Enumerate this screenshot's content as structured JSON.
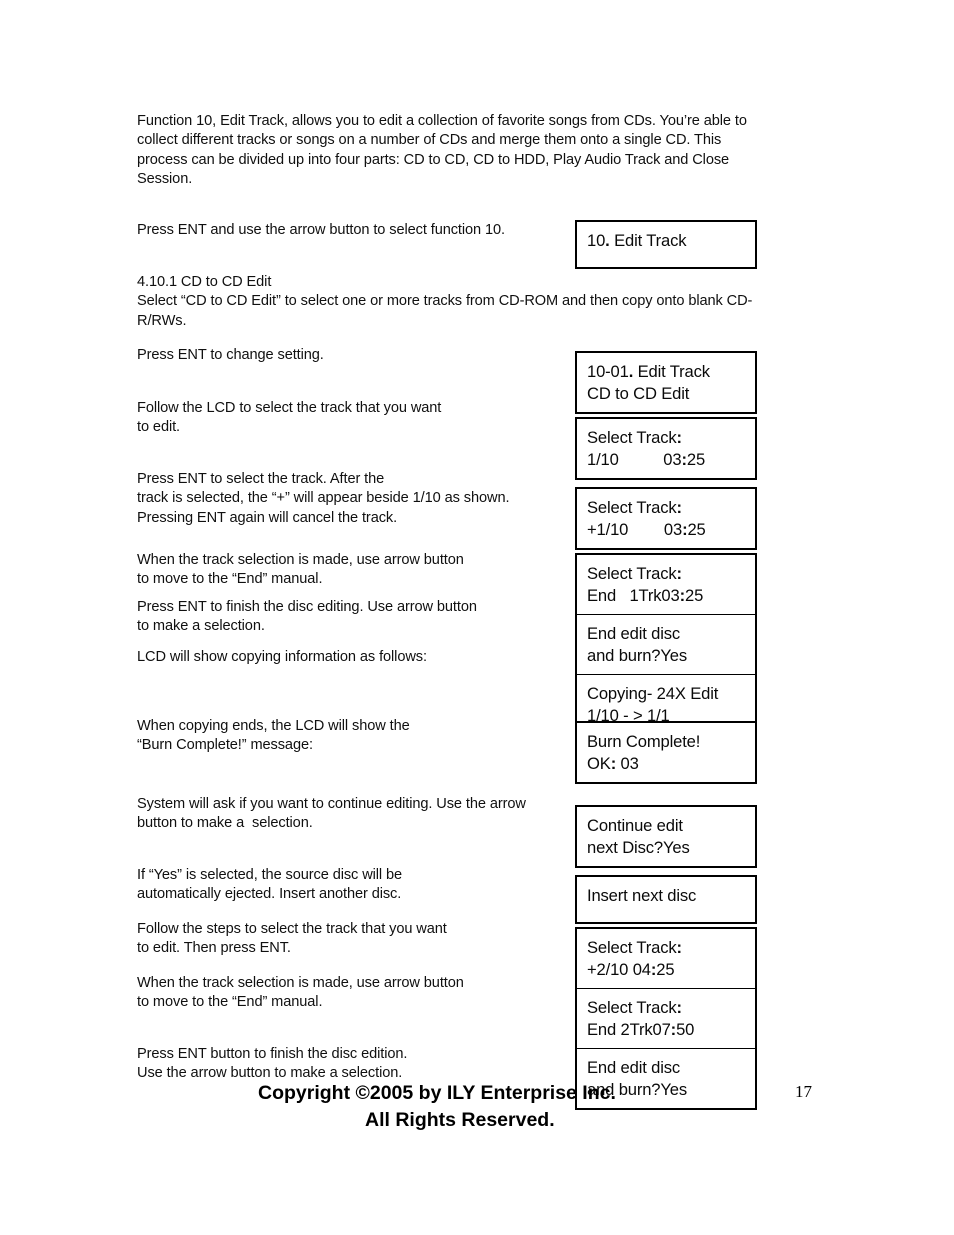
{
  "document": {
    "page_number": "17",
    "paragraphs": [
      {
        "id": "intro",
        "text": "Function 10, Edit Track, allows you to edit a collection of favorite songs from CDs. You’re able to\ncollect different tracks or songs on a number of CDs and merge them onto a single CD. This\nprocess can be divided up into four parts: CD to CD, CD to HDD, Play Audio Track and Close\nSession."
      },
      {
        "id": "press-ent-select-function",
        "text": "Press ENT and use the arrow button to select function 10."
      },
      {
        "id": "section-4-10-1",
        "text": "4.10.1 CD to CD Edit\nSelect “CD to CD Edit” to select one or more tracks from CD-ROM and then copy onto blank CD-\nR/RWs."
      },
      {
        "id": "press-ent-change-setting",
        "text": "Press ENT to change setting."
      },
      {
        "id": "follow-lcd-select-track",
        "text": "Follow the LCD to select the track that you want\nto edit."
      },
      {
        "id": "press-ent-select-track",
        "text": "Press ENT to select the track. After the\ntrack is selected, the “+” will appear beside 1/10 as shown.\nPressing ENT again will cancel the track."
      },
      {
        "id": "track-selection-made-1",
        "text": "When the track selection is made, use arrow button\nto move to the “End” manual."
      },
      {
        "id": "press-ent-finish-disc-editing",
        "text": "Press ENT to finish the disc editing. Use arrow button\nto make a selection."
      },
      {
        "id": "lcd-copying-info",
        "text": "LCD will show copying information as follows:"
      },
      {
        "id": "copying-ends",
        "text": "When copying ends, the LCD will show the\n“Burn Complete!” message:"
      },
      {
        "id": "system-will-ask",
        "text": "System will ask if you want to continue editing. Use the arrow\nbutton to make a  selection."
      },
      {
        "id": "if-yes-selected",
        "text": "If “Yes” is selected, the source disc will be\nautomatically ejected. Insert another disc."
      },
      {
        "id": "follow-steps-select-track",
        "text": "Follow the steps to select the track that you want\nto edit. Then press ENT."
      },
      {
        "id": "track-selection-made-2",
        "text": "When the track selection is made, use arrow button\nto move to the “End” manual."
      },
      {
        "id": "press-ent-finish-disc-edition",
        "text": "Press ENT button to finish the disc edition.\nUse the arrow button to make a selection."
      }
    ],
    "footer": {
      "line1": "Copyright ©2005 by ILY Enterprise Inc.",
      "line2": "All Rights Reserved."
    }
  },
  "lcd_displays": {
    "group1": [
      {
        "line1": "10",
        "bold": ".",
        "line1_rest": " Edit Track",
        "line2": ""
      }
    ],
    "box_function_10": {
      "line1_pre": "10",
      "line1_bold": ".",
      "line1_post": " Edit Track"
    },
    "box_10_01": {
      "line1_pre": "10-01",
      "line1_bold": ".",
      "line1_post": " Edit Track",
      "line2": "CD to CD Edit"
    },
    "box_select_track_1": {
      "line1_pre": "Select Track",
      "line1_bold": ":",
      "line1_post": "",
      "line2_pre": "1/10          03",
      "line2_bold": ":",
      "line2_post": "25"
    },
    "box_select_track_plus1": {
      "line1_pre": "Select Track",
      "line1_bold": ":",
      "line1_post": "",
      "line2_pre": "+1/10        03",
      "line2_bold": ":",
      "line2_post": "25"
    },
    "box_select_track_end1": {
      "line1_pre": "Select Track",
      "line1_bold": ":",
      "line1_post": "",
      "line2_pre": "End   1Trk03",
      "line2_bold": ":",
      "line2_post": "25"
    },
    "box_end_edit_disc_1": {
      "line1": "End edit disc",
      "line2": "and burn?Yes"
    },
    "box_copying": {
      "line1": "Copying- 24X Edit",
      "line2": "1/10 - > 1/1"
    },
    "box_burn_complete": {
      "line1": "Burn Complete!",
      "line2_pre": "OK",
      "line2_bold": ":",
      "line2_post": " 03"
    },
    "box_continue_edit": {
      "line1": "Continue edit",
      "line2": "next Disc?Yes"
    },
    "box_insert_next_disc": {
      "line1": "Insert next disc"
    },
    "box_select_track_plus2": {
      "line1_pre": "Select Track",
      "line1_bold": ":",
      "line1_post": "",
      "line2_pre": "+2/10 04",
      "line2_bold": ":",
      "line2_post": "25"
    },
    "box_select_track_end2": {
      "line1_pre": "Select Track",
      "line1_bold": ":",
      "line1_post": "",
      "line2_pre": "End 2Trk07",
      "line2_bold": ":",
      "line2_post": "50"
    },
    "box_end_edit_disc_2": {
      "line1": "End edit disc",
      "line2": "and burn?Yes"
    }
  }
}
